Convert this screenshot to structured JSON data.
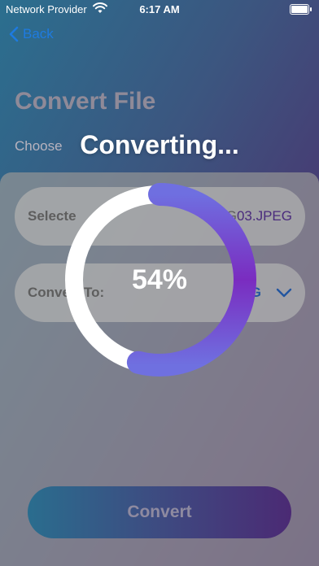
{
  "status_bar": {
    "carrier": "Network Provider",
    "time": "6:17 AM",
    "battery": "full"
  },
  "nav": {
    "back_label": "Back"
  },
  "header": {
    "title": "Convert File",
    "subtitle": "Choose"
  },
  "form": {
    "selected_label": "Selecte",
    "selected_value_prefix": "IMG",
    "selected_value_ext": "03.JPEG",
    "convert_to_label": "Convert To:",
    "convert_to_value": "P G"
  },
  "convert_button": {
    "label": "Convert"
  },
  "overlay": {
    "title": "Converting...",
    "progress": 0.54,
    "progress_label": "54%"
  },
  "colors": {
    "accent": "#1e7be0",
    "ring_start": "#6f6fe0",
    "ring_end": "#7a2cc0",
    "ring_track": "#ffffff"
  }
}
